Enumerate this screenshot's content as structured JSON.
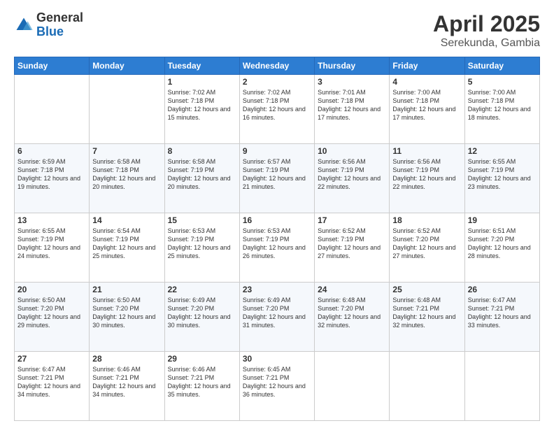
{
  "header": {
    "logo_general": "General",
    "logo_blue": "Blue",
    "title": "April 2025",
    "location": "Serekunda, Gambia"
  },
  "days_of_week": [
    "Sunday",
    "Monday",
    "Tuesday",
    "Wednesday",
    "Thursday",
    "Friday",
    "Saturday"
  ],
  "weeks": [
    [
      {
        "day": "",
        "info": ""
      },
      {
        "day": "",
        "info": ""
      },
      {
        "day": "1",
        "info": "Sunrise: 7:02 AM\nSunset: 7:18 PM\nDaylight: 12 hours and 15 minutes."
      },
      {
        "day": "2",
        "info": "Sunrise: 7:02 AM\nSunset: 7:18 PM\nDaylight: 12 hours and 16 minutes."
      },
      {
        "day": "3",
        "info": "Sunrise: 7:01 AM\nSunset: 7:18 PM\nDaylight: 12 hours and 17 minutes."
      },
      {
        "day": "4",
        "info": "Sunrise: 7:00 AM\nSunset: 7:18 PM\nDaylight: 12 hours and 17 minutes."
      },
      {
        "day": "5",
        "info": "Sunrise: 7:00 AM\nSunset: 7:18 PM\nDaylight: 12 hours and 18 minutes."
      }
    ],
    [
      {
        "day": "6",
        "info": "Sunrise: 6:59 AM\nSunset: 7:18 PM\nDaylight: 12 hours and 19 minutes."
      },
      {
        "day": "7",
        "info": "Sunrise: 6:58 AM\nSunset: 7:18 PM\nDaylight: 12 hours and 20 minutes."
      },
      {
        "day": "8",
        "info": "Sunrise: 6:58 AM\nSunset: 7:19 PM\nDaylight: 12 hours and 20 minutes."
      },
      {
        "day": "9",
        "info": "Sunrise: 6:57 AM\nSunset: 7:19 PM\nDaylight: 12 hours and 21 minutes."
      },
      {
        "day": "10",
        "info": "Sunrise: 6:56 AM\nSunset: 7:19 PM\nDaylight: 12 hours and 22 minutes."
      },
      {
        "day": "11",
        "info": "Sunrise: 6:56 AM\nSunset: 7:19 PM\nDaylight: 12 hours and 22 minutes."
      },
      {
        "day": "12",
        "info": "Sunrise: 6:55 AM\nSunset: 7:19 PM\nDaylight: 12 hours and 23 minutes."
      }
    ],
    [
      {
        "day": "13",
        "info": "Sunrise: 6:55 AM\nSunset: 7:19 PM\nDaylight: 12 hours and 24 minutes."
      },
      {
        "day": "14",
        "info": "Sunrise: 6:54 AM\nSunset: 7:19 PM\nDaylight: 12 hours and 25 minutes."
      },
      {
        "day": "15",
        "info": "Sunrise: 6:53 AM\nSunset: 7:19 PM\nDaylight: 12 hours and 25 minutes."
      },
      {
        "day": "16",
        "info": "Sunrise: 6:53 AM\nSunset: 7:19 PM\nDaylight: 12 hours and 26 minutes."
      },
      {
        "day": "17",
        "info": "Sunrise: 6:52 AM\nSunset: 7:19 PM\nDaylight: 12 hours and 27 minutes."
      },
      {
        "day": "18",
        "info": "Sunrise: 6:52 AM\nSunset: 7:20 PM\nDaylight: 12 hours and 27 minutes."
      },
      {
        "day": "19",
        "info": "Sunrise: 6:51 AM\nSunset: 7:20 PM\nDaylight: 12 hours and 28 minutes."
      }
    ],
    [
      {
        "day": "20",
        "info": "Sunrise: 6:50 AM\nSunset: 7:20 PM\nDaylight: 12 hours and 29 minutes."
      },
      {
        "day": "21",
        "info": "Sunrise: 6:50 AM\nSunset: 7:20 PM\nDaylight: 12 hours and 30 minutes."
      },
      {
        "day": "22",
        "info": "Sunrise: 6:49 AM\nSunset: 7:20 PM\nDaylight: 12 hours and 30 minutes."
      },
      {
        "day": "23",
        "info": "Sunrise: 6:49 AM\nSunset: 7:20 PM\nDaylight: 12 hours and 31 minutes."
      },
      {
        "day": "24",
        "info": "Sunrise: 6:48 AM\nSunset: 7:20 PM\nDaylight: 12 hours and 32 minutes."
      },
      {
        "day": "25",
        "info": "Sunrise: 6:48 AM\nSunset: 7:21 PM\nDaylight: 12 hours and 32 minutes."
      },
      {
        "day": "26",
        "info": "Sunrise: 6:47 AM\nSunset: 7:21 PM\nDaylight: 12 hours and 33 minutes."
      }
    ],
    [
      {
        "day": "27",
        "info": "Sunrise: 6:47 AM\nSunset: 7:21 PM\nDaylight: 12 hours and 34 minutes."
      },
      {
        "day": "28",
        "info": "Sunrise: 6:46 AM\nSunset: 7:21 PM\nDaylight: 12 hours and 34 minutes."
      },
      {
        "day": "29",
        "info": "Sunrise: 6:46 AM\nSunset: 7:21 PM\nDaylight: 12 hours and 35 minutes."
      },
      {
        "day": "30",
        "info": "Sunrise: 6:45 AM\nSunset: 7:21 PM\nDaylight: 12 hours and 36 minutes."
      },
      {
        "day": "",
        "info": ""
      },
      {
        "day": "",
        "info": ""
      },
      {
        "day": "",
        "info": ""
      }
    ]
  ]
}
